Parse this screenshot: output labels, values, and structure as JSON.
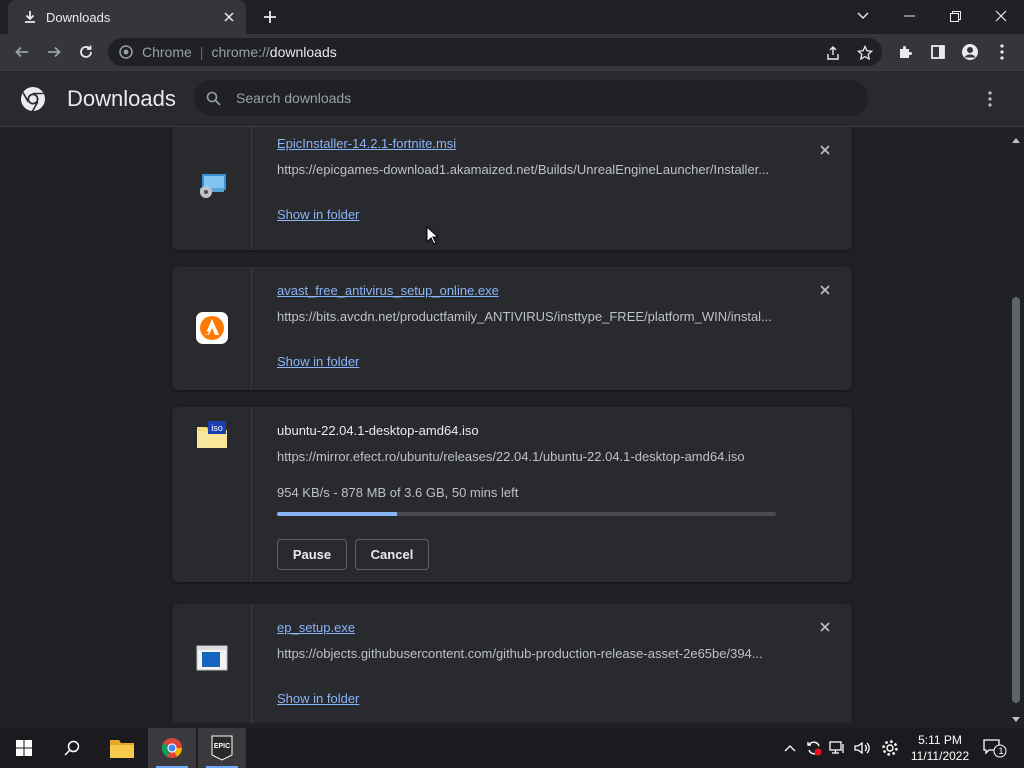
{
  "browser": {
    "tab": {
      "title": "Downloads",
      "icon": "download-icon"
    },
    "omnibox": {
      "site_label": "Chrome",
      "url_scheme": "chrome://",
      "url_host": "downloads"
    }
  },
  "downloads_page": {
    "title": "Downloads",
    "search_placeholder": "Search downloads",
    "items": [
      {
        "filename": "EpicInstaller-14.2.1-fortnite.msi",
        "url": "https://epicgames-download1.akamaized.net/Builds/UnrealEngineLauncher/Installer...",
        "action": "Show in folder",
        "icon": "msi-installer-icon"
      },
      {
        "filename": "avast_free_antivirus_setup_online.exe",
        "url": "https://bits.avcdn.net/productfamily_ANTIVIRUS/insttype_FREE/platform_WIN/instal...",
        "action": "Show in folder",
        "icon": "avast-icon"
      },
      {
        "filename": "ubuntu-22.04.1-desktop-amd64.iso",
        "url": "https://mirror.efect.ro/ubuntu/releases/22.04.1/ubuntu-22.04.1-desktop-amd64.iso",
        "status": "954 KB/s - 878 MB of 3.6 GB, 50 mins left",
        "progress": 0.24,
        "pause_label": "Pause",
        "cancel_label": "Cancel",
        "icon": "iso-file-icon"
      },
      {
        "filename": "ep_setup.exe",
        "url": "https://objects.githubusercontent.com/github-production-release-asset-2e65be/394...",
        "action": "Show in folder",
        "icon": "exe-window-icon"
      }
    ]
  },
  "taskbar": {
    "time": "5:11 PM",
    "date": "11/11/2022",
    "notification_count": "1"
  },
  "colors": {
    "accent": "#8ab4f8",
    "background": "#202124",
    "card": "#292a2d"
  }
}
